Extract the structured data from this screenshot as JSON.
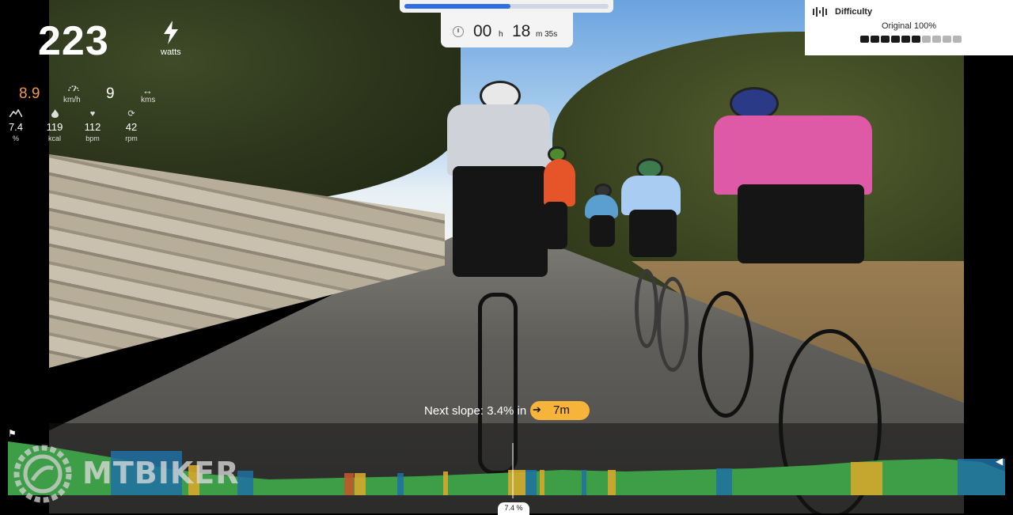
{
  "stats": {
    "power": {
      "value": "223",
      "unit": "watts",
      "icon": "bolt-icon"
    },
    "speed": {
      "value": "8.9",
      "unit": "km/h",
      "icon": "speedometer-icon",
      "color": "#f39a4a"
    },
    "distance": {
      "value": "9",
      "unit": "kms",
      "icon": "horizontal-arrows-icon"
    },
    "grade": {
      "value": "7.4",
      "unit": "%",
      "icon": "mountain-icon"
    },
    "calories": {
      "value": "119",
      "unit": "kcal",
      "icon": "flame-icon"
    },
    "heart_rate": {
      "value": "112",
      "unit": "bpm",
      "icon": "heart-icon"
    },
    "cadence": {
      "value": "42",
      "unit": "rpm",
      "icon": "cycle-arrows-icon"
    }
  },
  "progress": {
    "fraction": 0.52,
    "color": "#2f6fe0"
  },
  "timer": {
    "hours": "00",
    "hours_unit": "h",
    "minutes": "18",
    "minutes_unit": "m",
    "seconds": "35s",
    "icon": "clock-icon"
  },
  "difficulty": {
    "title": "Difficulty",
    "icon": "sliders-icon",
    "preset": "Original 100%",
    "level": 6,
    "segments": 10,
    "active_color": "#1a1a1a",
    "inactive_color": "#b5b5b5"
  },
  "next_slope": {
    "label": "Next slope: 3.4% in",
    "distance": "7m",
    "pill_color": "#f6b53a"
  },
  "profile": {
    "current_grade": "7.4 %",
    "colors": {
      "easy": "#3e9e47",
      "moderate": "#1f6ea3",
      "steep": "#d4a62c",
      "hard": "#c0562a"
    }
  },
  "watermark": {
    "brand": "MTBIKER"
  }
}
